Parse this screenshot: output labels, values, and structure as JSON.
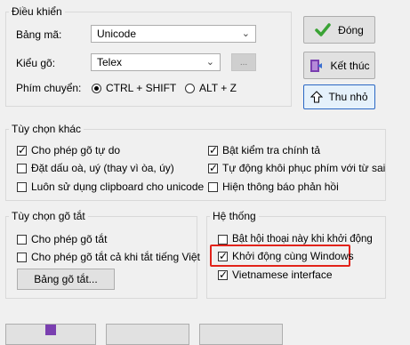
{
  "controls": {
    "legend": "Điều khiển",
    "charset_label": "Bảng mã:",
    "charset_value": "Unicode",
    "input_label": "Kiểu gõ:",
    "input_value": "Telex",
    "input_more": "...",
    "switch_label": "Phím chuyển:",
    "switch_options": [
      "CTRL + SHIFT",
      "ALT + Z"
    ],
    "switch_selected": "CTRL + SHIFT"
  },
  "buttons": {
    "close": "Đóng",
    "exit": "Kết thúc",
    "minimize": "Thu nhỏ"
  },
  "other": {
    "legend": "Tùy chọn khác",
    "items": [
      {
        "label": "Cho phép gõ tự do",
        "checked": true
      },
      {
        "label": "Đặt dấu oà, uý (thay vì òa, úy)",
        "checked": false
      },
      {
        "label": "Luôn sử dụng clipboard cho unicode",
        "checked": false
      },
      {
        "label": "Bật kiểm tra chính tả",
        "checked": true
      },
      {
        "label": "Tự động khôi phục phím với từ sai",
        "checked": true
      },
      {
        "label": "Hiện thông báo phản hồi",
        "checked": false
      }
    ]
  },
  "shorthand": {
    "legend": "Tùy chọn gõ tắt",
    "items": [
      {
        "label": "Cho phép gõ tắt",
        "checked": false
      },
      {
        "label": "Cho phép gõ tắt cả khi tắt tiếng Việt",
        "checked": false
      }
    ],
    "table_button": "Bảng gõ tắt..."
  },
  "system": {
    "legend": "Hệ thống",
    "items": [
      {
        "label": "Bật hội thoại này khi khởi động",
        "checked": false
      },
      {
        "label": "Khởi động cùng Windows",
        "checked": true
      },
      {
        "label": "Vietnamese interface",
        "checked": true
      }
    ]
  },
  "colors": {
    "highlight": "#e2231a",
    "focus_border": "#2b68c4"
  }
}
